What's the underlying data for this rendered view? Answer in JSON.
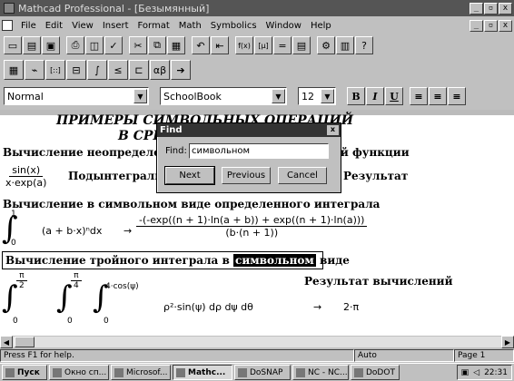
{
  "window": {
    "title": "Mathcad Professional - [Безымянный]"
  },
  "menu": [
    "File",
    "Edit",
    "View",
    "Insert",
    "Format",
    "Math",
    "Symbolics",
    "Window",
    "Help"
  ],
  "toolbar1_icons": [
    "new-icon",
    "open-icon",
    "save-icon",
    "print-icon",
    "preview-icon",
    "spell-icon",
    "cut-icon",
    "copy-icon",
    "paste-icon",
    "undo-icon",
    "align-icon",
    "insert-function-icon",
    "insert-unit-icon",
    "calculate-icon",
    "equals-icon",
    "component-icon",
    "insert-component-icon",
    "help-icon"
  ],
  "toolbar1_glyphs": [
    "▭",
    "▤",
    "▣",
    "⎙",
    "◫",
    "✓",
    "✂",
    "⧉",
    "▦",
    "↶",
    "⇤",
    "f(x)",
    "[μ]",
    "=",
    "▤",
    "⚙",
    "▥",
    "?"
  ],
  "toolbar2_icons": [
    "calculator-icon",
    "graph-icon",
    "matrix-icon",
    "evaluation-icon",
    "calculus-icon",
    "boolean-icon",
    "programming-icon",
    "greek-icon",
    "symbolic-icon"
  ],
  "toolbar2_glyphs": [
    "▦",
    "⌁",
    "[::]",
    "⊟",
    "∫",
    "≤",
    "⊏",
    "αβ",
    "➔"
  ],
  "format": {
    "style": "Normal",
    "font": "SchoolBook",
    "size": "12",
    "bold": "B",
    "italic": "I",
    "underline": "U"
  },
  "document": {
    "heading1": "ПРИМЕРЫ СИМВОЛЬНЫХ ОПЕРАЦИЙ",
    "heading2": "В СРЕДЕ MATHCAD",
    "line1": "Вычисление неопределенного интеграла от заданной функции",
    "frac1_num": "sin(x)",
    "frac1_den": "x·exp(a)",
    "line2_left": "Подынтегральная функция",
    "line2_right": "Результат",
    "line3": "Вычисление в символьном виде определенного интеграла",
    "int2_upper": "1",
    "int2_lower": "0",
    "int2_body": "(a + b·x)ⁿdx",
    "res2_num": "-(-exp((n + 1)·ln(a + b)) + exp((n + 1)·ln(a)))",
    "res2_den": "(b·(n + 1))",
    "arrow": "→",
    "line4_before": "Вычисление тройного интеграла в ",
    "line4_highlight": "символьном",
    "line4_after": " виде",
    "line5": "Результат вычислений",
    "int_a_upper_num": "π",
    "int_a_upper_den": "2",
    "int_a_lower": "0",
    "int_b_upper_num": "π",
    "int_b_upper_den": "4",
    "int_b_lower": "0",
    "int_c_upper": "4·cos(ψ)",
    "int_c_lower": "0",
    "int3_body": "ρ²·sin(ψ) dρ dψ dθ",
    "result3": "2·π"
  },
  "find_dialog": {
    "title": "Find",
    "label": "Find:",
    "value": "символьном",
    "next": "Next",
    "previous": "Previous",
    "cancel": "Cancel"
  },
  "status": {
    "help": "Press F1 for help.",
    "mode": "Auto",
    "page": "Page 1"
  },
  "taskbar": {
    "start": "Пуск",
    "tasks": [
      "Окно сп...",
      "Microsof...",
      "Mathc...",
      "DoSNAP",
      "NC - NC...",
      "DoDOT"
    ],
    "clock": "22:31"
  }
}
